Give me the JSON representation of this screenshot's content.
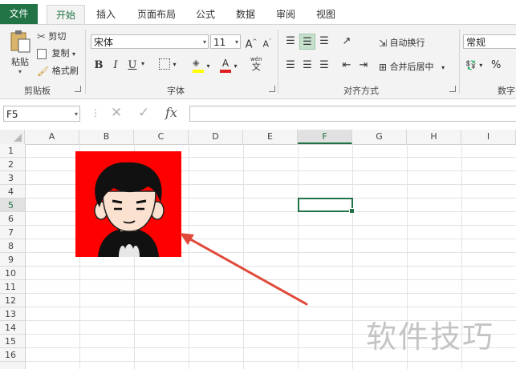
{
  "tabs": [
    "文件",
    "开始",
    "插入",
    "页面布局",
    "公式",
    "数据",
    "审阅",
    "视图"
  ],
  "clipboard": {
    "paste": "粘贴",
    "cut": "剪切",
    "copy": "复制",
    "format_painter": "格式刷",
    "group": "剪贴板"
  },
  "font": {
    "name": "宋体",
    "size": "11",
    "bold": "B",
    "italic": "I",
    "underline": "U",
    "grow": "A",
    "shrink": "A",
    "phonetic_top": "wén",
    "phonetic_main": "文",
    "group": "字体"
  },
  "alignment": {
    "wrap": "自动换行",
    "merge": "合并后居中",
    "group": "对齐方式"
  },
  "number": {
    "format": "常规",
    "percent": "%",
    "group": "数字"
  },
  "formula_bar": {
    "name_box": "F5",
    "cancel": "✕",
    "enter": "✓",
    "fx": "fx",
    "content": ""
  },
  "columns": [
    "A",
    "B",
    "C",
    "D",
    "E",
    "F",
    "G",
    "H",
    "I"
  ],
  "rows": [
    "1",
    "2",
    "3",
    "4",
    "5",
    "6",
    "7",
    "8",
    "9",
    "10",
    "11",
    "12",
    "13",
    "14",
    "15",
    "16"
  ],
  "active_column": "F",
  "active_row": "5",
  "watermark": "软件技巧",
  "colors": {
    "excel_green": "#217346",
    "avatar_background": "#ff0000",
    "arrow": "#e0493a"
  }
}
